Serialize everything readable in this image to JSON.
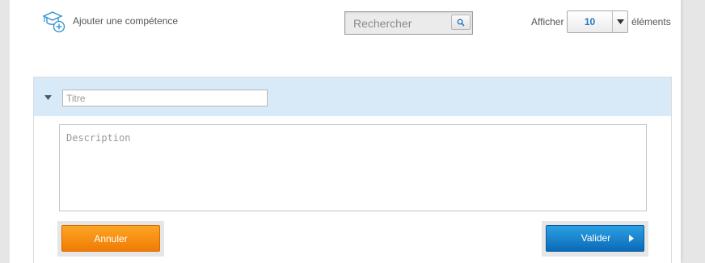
{
  "toolbar": {
    "add_skill_label": "Ajouter une compétence",
    "add_skill_icon": "graduation-cap-add-icon",
    "search_placeholder": "Rechercher",
    "search_icon": "magnifier-icon",
    "show_label": "Afficher",
    "per_page_value": "10",
    "elements_label": "éléments"
  },
  "form": {
    "title_placeholder": "Titre",
    "description_placeholder": "Description",
    "cancel_label": "Annuler",
    "validate_label": "Valider"
  },
  "colors": {
    "header_band": "#d8eaf7",
    "accent_blue": "#2a78c2",
    "cancel_orange": "#f5900f",
    "validate_blue": "#1682cf"
  }
}
